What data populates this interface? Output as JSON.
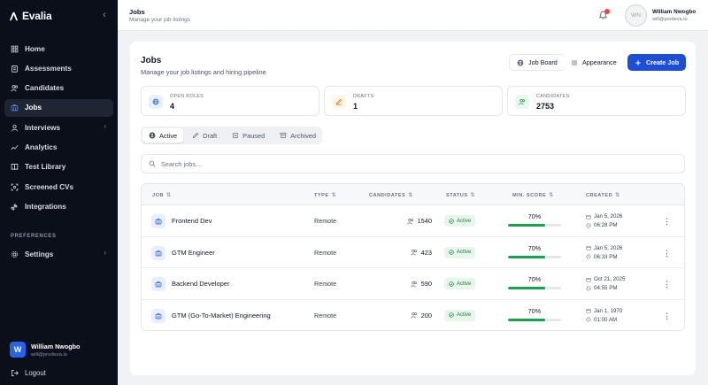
{
  "app": {
    "name": "Evalia"
  },
  "sidebar": {
    "items": [
      {
        "label": "Home",
        "icon": "home-icon"
      },
      {
        "label": "Assessments",
        "icon": "clipboard-icon"
      },
      {
        "label": "Candidates",
        "icon": "users-icon"
      },
      {
        "label": "Jobs",
        "icon": "briefcase-icon",
        "active": true
      },
      {
        "label": "Interviews",
        "icon": "interview-icon",
        "chevron": true
      },
      {
        "label": "Analytics",
        "icon": "analytics-icon"
      },
      {
        "label": "Test Library",
        "icon": "book-icon"
      },
      {
        "label": "Screened CVs",
        "icon": "scan-icon"
      },
      {
        "label": "Integrations",
        "icon": "plug-icon"
      }
    ],
    "preferences_label": "PREFERENCES",
    "settings_label": "Settings",
    "user": {
      "initial": "W",
      "name": "William Nwogbo",
      "email": "will@prodeva.io"
    },
    "logout_label": "Logout"
  },
  "topbar": {
    "title": "Jobs",
    "subtitle": "Manage your job listings",
    "avatar_initials": "WN",
    "user_name": "William Nwogbo",
    "user_email": "will@prodeva.io"
  },
  "main": {
    "title": "Jobs",
    "subtitle": "Manage your job listings and hiring pipeline",
    "buttons": {
      "job_board": "Job Board",
      "appearance": "Appearance",
      "create_job": "Create Job"
    },
    "stats": [
      {
        "label": "OPEN ROLES",
        "value": "4",
        "icon": "globe-icon",
        "color": "#eaf1fe"
      },
      {
        "label": "DRAFTS",
        "value": "1",
        "icon": "pencil-icon",
        "color": "#fef6e4"
      },
      {
        "label": "CANDIDATES",
        "value": "2753",
        "icon": "users-icon",
        "color": "#e9f7ee"
      }
    ],
    "tabs": [
      {
        "label": "Active",
        "icon": "globe-icon",
        "active": true
      },
      {
        "label": "Draft",
        "icon": "pencil-icon"
      },
      {
        "label": "Paused",
        "icon": "pause-icon"
      },
      {
        "label": "Archived",
        "icon": "archive-icon"
      }
    ],
    "search": {
      "placeholder": "Search jobs..."
    },
    "table": {
      "columns": [
        "JOB",
        "TYPE",
        "CANDIDATES",
        "STATUS",
        "MIN. SCORE",
        "CREATED"
      ],
      "rows": [
        {
          "name": "Frontend Dev",
          "type": "Remote",
          "candidates": "1540",
          "status": "Active",
          "min_score": "70%",
          "score_value": 70,
          "date": "Jan 5, 2026",
          "time": "06:28 PM"
        },
        {
          "name": "GTM Engineer",
          "type": "Remote",
          "candidates": "423",
          "status": "Active",
          "min_score": "70%",
          "score_value": 70,
          "date": "Jan 5, 2026",
          "time": "06:33 PM"
        },
        {
          "name": "Backend Developer",
          "type": "Remote",
          "candidates": "590",
          "status": "Active",
          "min_score": "70%",
          "score_value": 70,
          "date": "Oct 21, 2025",
          "time": "04:55 PM"
        },
        {
          "name": "GTM (Go-To-Market) Engineering",
          "type": "Remote",
          "candidates": "200",
          "status": "Active",
          "min_score": "70%",
          "score_value": 70,
          "date": "Jan 1, 1970",
          "time": "01:00 AM"
        }
      ]
    }
  },
  "colors": {
    "accent": "#1d4ed8",
    "sidebar_bg": "#0b0f19",
    "success": "#16a34a"
  }
}
